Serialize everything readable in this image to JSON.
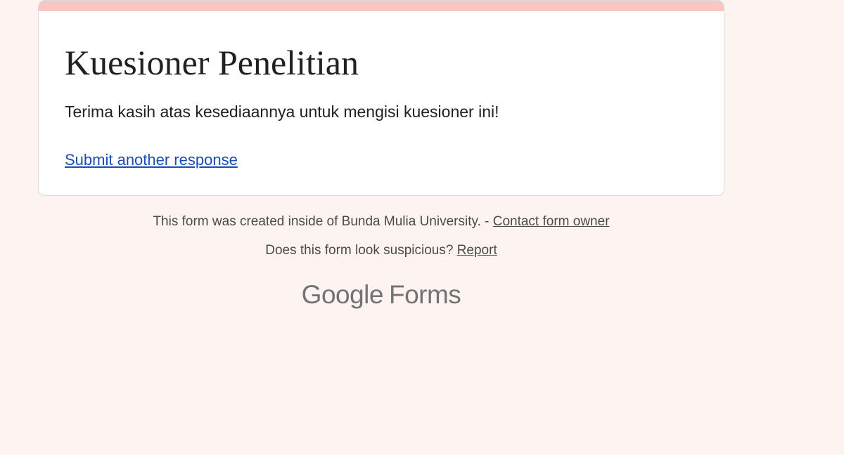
{
  "theme": {
    "accent_color": "#f6c7c3",
    "background_color": "#fdf3f1",
    "link_color": "#1a4db5"
  },
  "card": {
    "title": "Kuesioner Penelitian",
    "message": "Terima kasih atas kesediaannya untuk mengisi kuesioner ini!",
    "submit_another_label": "Submit another response"
  },
  "footer": {
    "created_text": "This form was created inside of Bunda Mulia University. - ",
    "contact_label": "Contact form owner",
    "suspicious_text": "Does this form look suspicious? ",
    "report_label": "Report"
  },
  "branding": {
    "logo_word_1": "Google",
    "logo_word_2": "Forms"
  }
}
